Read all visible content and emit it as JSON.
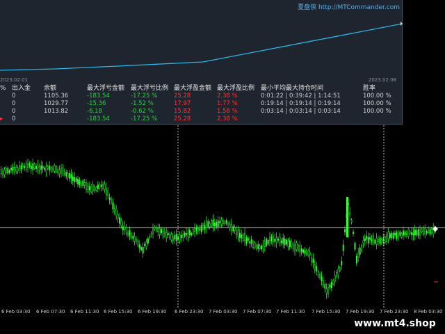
{
  "panel": {
    "title": "夏盘侠 http://MTCommander.com",
    "date_left": "2023.02.01",
    "date_right": "2023.02.08",
    "headers": [
      "%",
      "出入金",
      "余额",
      "最大浮亏金额",
      "最大浮亏比例",
      "最大浮盈金额",
      "最大浮盈比例",
      "最小平均最大持仓时间",
      "胜率"
    ],
    "rows": [
      {
        "deposit": "0",
        "balance": "1105.36",
        "max_loss": "-183.54",
        "max_loss_pct": "-17.25 %",
        "max_profit": "25.28",
        "max_profit_pct": "2.38 %",
        "hold": "0:01:22 | 0:39:42 | 1:14:51",
        "win": "100.00 %"
      },
      {
        "deposit": "0",
        "balance": "1029.77",
        "max_loss": "-15.36",
        "max_loss_pct": "-1.52 %",
        "max_profit": "17.97",
        "max_profit_pct": "1.77 %",
        "hold": "0:19:14 | 0:19:14 | 0:19:14",
        "win": "100.00 %"
      },
      {
        "deposit": "0",
        "balance": "1013.82",
        "max_loss": "-6.18",
        "max_loss_pct": "-0.62 %",
        "max_profit": "15.82",
        "max_profit_pct": "1.58 %",
        "hold": "0:03:14 | 0:03:14 | 0:03:14",
        "win": "100.00 %"
      }
    ],
    "total": {
      "deposit": "0",
      "max_loss": "-183.54",
      "max_loss_pct": "-17.25 %",
      "max_profit": "25.28",
      "max_profit_pct": "2.38 %"
    }
  },
  "timeline": [
    "6 Feb 03:30",
    "6 Feb 07:30",
    "6 Feb 11:30",
    "6 Feb 15:30",
    "6 Feb 19:30",
    "6 Feb 23:30",
    "7 Feb 03:30",
    "7 Feb 07:30",
    "7 Feb 11:30",
    "7 Feb 15:30",
    "7 Feb 19:30",
    "7 Feb 23:30",
    "8 Feb 03:30"
  ],
  "brand": "www.mt4.shop",
  "colors": {
    "candle": "#33ff33",
    "equity_line": "#29b6e8",
    "grid": "#c0c0c0",
    "loss": "#22d63a",
    "profit": "#ff3333"
  }
}
